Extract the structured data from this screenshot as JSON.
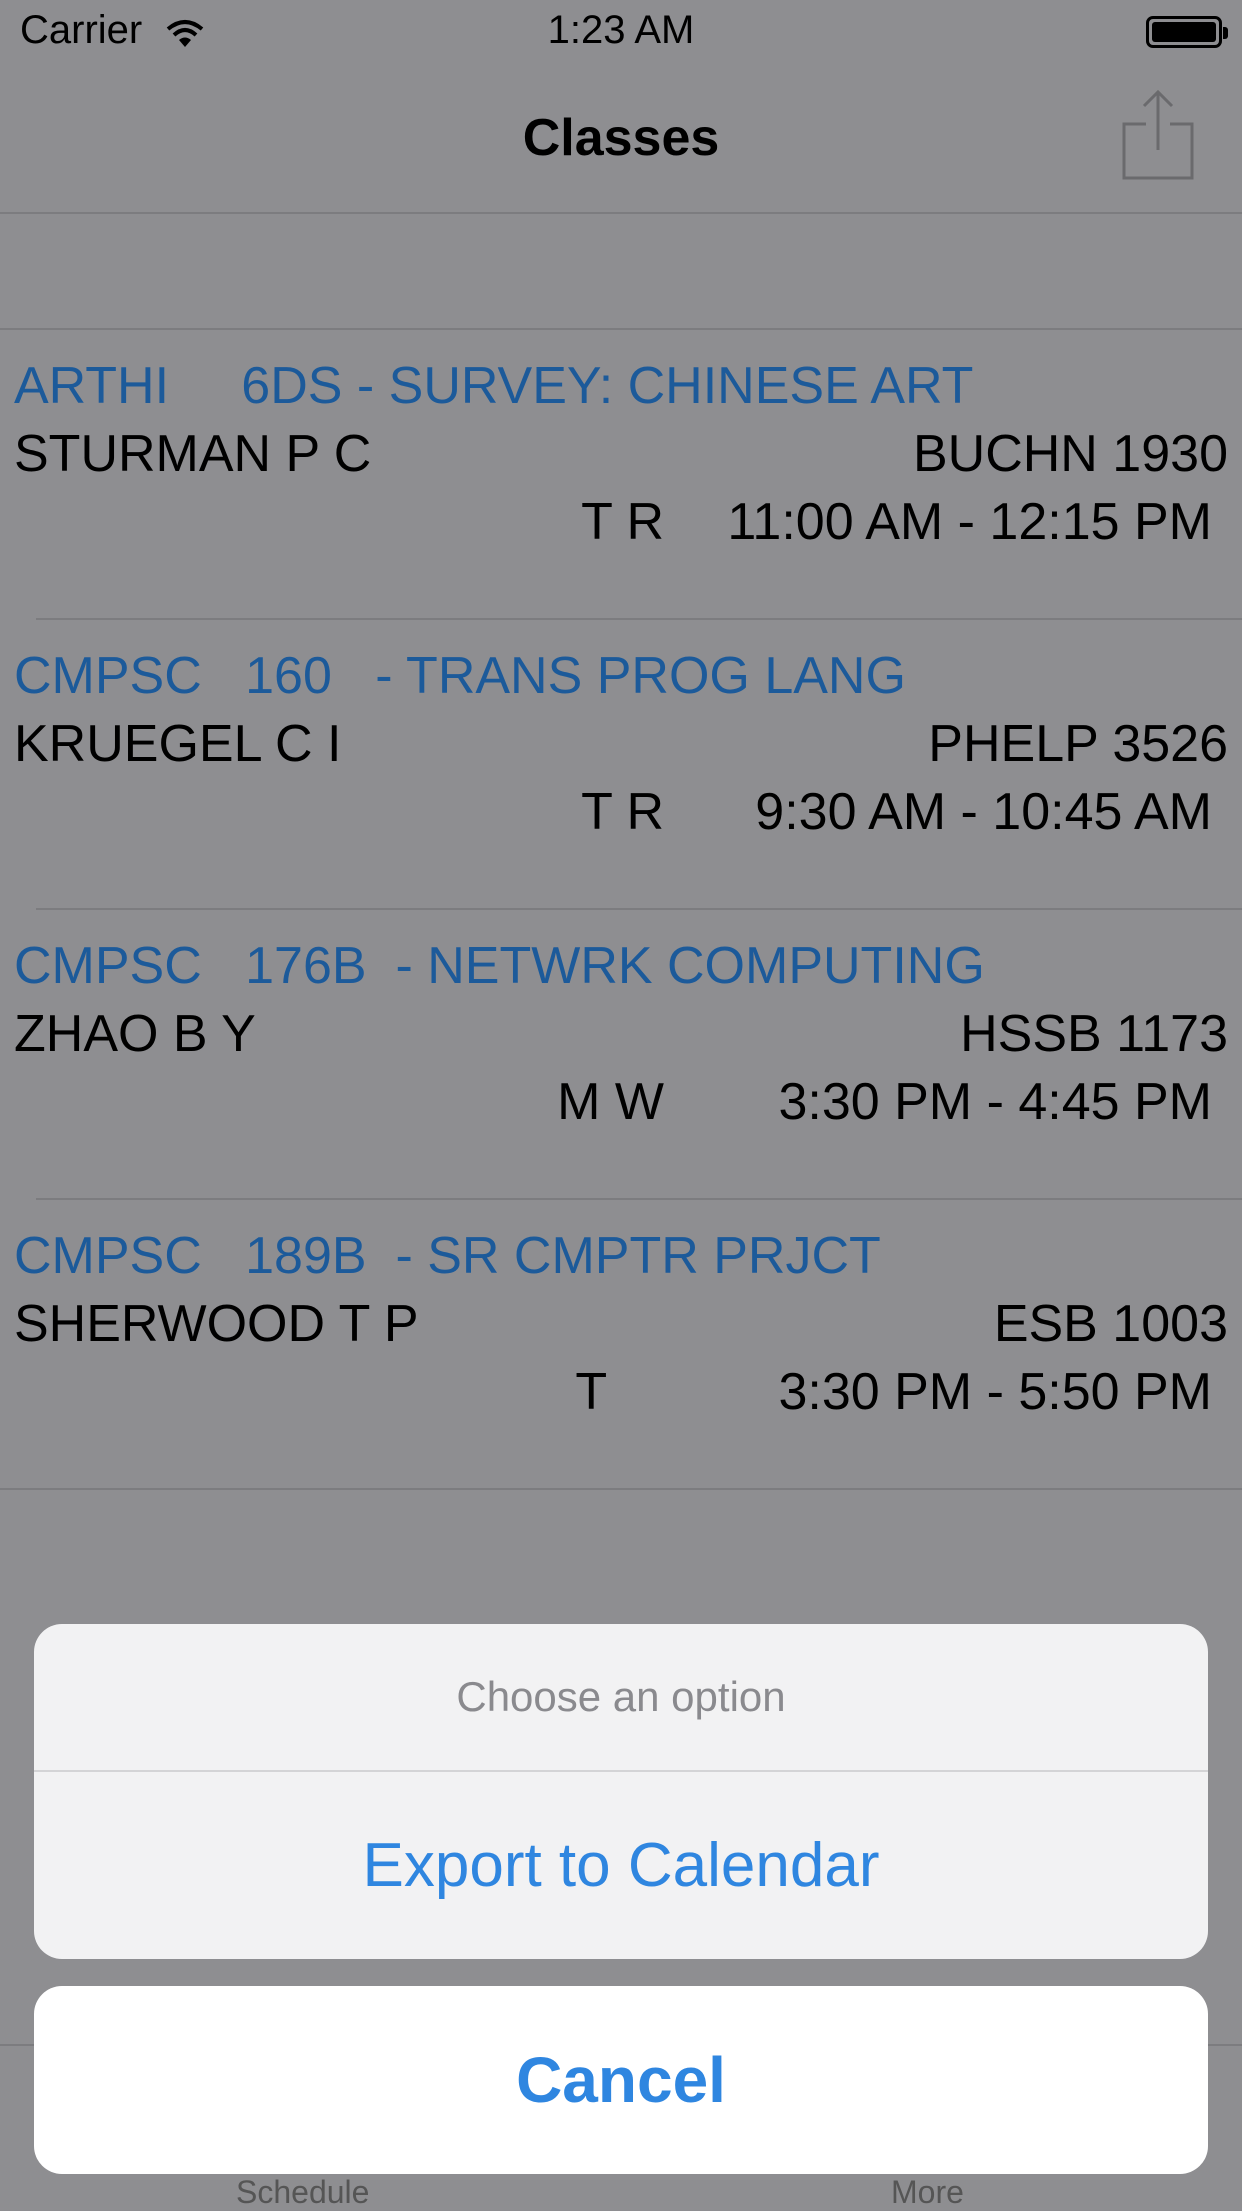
{
  "status_bar": {
    "carrier": "Carrier",
    "time": "1:23 AM"
  },
  "nav": {
    "title": "Classes",
    "share_icon": "share-icon"
  },
  "classes": [
    {
      "course": "ARTHI     6DS - SURVEY: CHINESE ART",
      "instructor": "STURMAN P C",
      "location": "BUCHN 1930",
      "days": "T R",
      "time": "11:00 AM - 12:15 PM"
    },
    {
      "course": "CMPSC   160   - TRANS PROG LANG",
      "instructor": "KRUEGEL C I",
      "location": "PHELP 3526",
      "days": "T R",
      "time": "9:30 AM - 10:45 AM"
    },
    {
      "course": "CMPSC   176B  - NETWRK COMPUTING",
      "instructor": "ZHAO B Y",
      "location": "HSSB 1173",
      "days": "M W",
      "time": "3:30 PM - 4:45 PM"
    },
    {
      "course": "CMPSC   189B  - SR CMPTR PRJCT",
      "instructor": "SHERWOOD T P",
      "location": "ESB 1003",
      "days": "T    ",
      "time": "3:30 PM - 5:50 PM"
    }
  ],
  "action_sheet": {
    "prompt": "Choose an option",
    "export_label": "Export to Calendar",
    "cancel_label": "Cancel"
  },
  "tab_bar": {
    "tabs": [
      {
        "label": "Schedule"
      },
      {
        "label": "More"
      }
    ]
  },
  "colors": {
    "course_title": "#1c5a9a",
    "action_blue": "#2f86e0",
    "dim_background": "#8e8e91"
  }
}
